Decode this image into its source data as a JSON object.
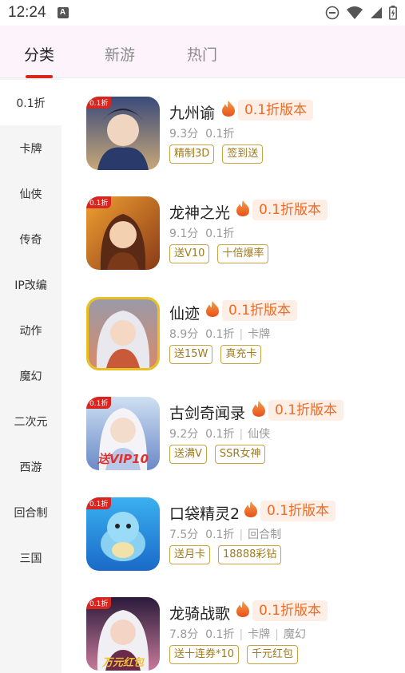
{
  "status_bar": {
    "time": "12:24",
    "notif_letter": "A"
  },
  "tabs": [
    {
      "label": "分类",
      "active": true
    },
    {
      "label": "新游",
      "active": false
    },
    {
      "label": "热门",
      "active": false
    }
  ],
  "sidebar": {
    "items": [
      {
        "label": "0.1折",
        "active": true
      },
      {
        "label": "卡牌"
      },
      {
        "label": "仙侠"
      },
      {
        "label": "传奇"
      },
      {
        "label": "IP改编"
      },
      {
        "label": "动作"
      },
      {
        "label": "魔幻"
      },
      {
        "label": "二次元"
      },
      {
        "label": "西游"
      },
      {
        "label": "回合制"
      },
      {
        "label": "三国"
      }
    ]
  },
  "games": [
    {
      "name": "九州谕",
      "promo": "0.1折版本",
      "score": "9.3分",
      "discount": "0.1折",
      "categories": [],
      "tags": [
        "精制3D",
        "签到送"
      ],
      "icon_badge": "0.1折",
      "icon_text": ""
    },
    {
      "name": "龙神之光",
      "promo": "0.1折版本",
      "score": "9.1分",
      "discount": "0.1折",
      "categories": [],
      "tags": [
        "送V10",
        "十倍爆率"
      ],
      "icon_badge": "0.1折",
      "icon_text": ""
    },
    {
      "name": "仙迹",
      "promo": "0.1折版本",
      "score": "8.9分",
      "discount": "0.1折",
      "categories": [
        "卡牌"
      ],
      "tags": [
        "送15W",
        "真充卡"
      ],
      "icon_badge": "",
      "icon_text": ""
    },
    {
      "name": "古剑奇闻录",
      "promo": "0.1折版本",
      "score": "9.2分",
      "discount": "0.1折",
      "categories": [
        "仙侠"
      ],
      "tags": [
        "送满V",
        "SSR女神"
      ],
      "icon_badge": "0.1折",
      "icon_text": "送VIP10"
    },
    {
      "name": "口袋精灵2",
      "promo": "0.1折版本",
      "score": "7.5分",
      "discount": "0.1折",
      "categories": [
        "回合制"
      ],
      "tags": [
        "送月卡",
        "18888彩钻"
      ],
      "icon_badge": "0.1折",
      "icon_text": ""
    },
    {
      "name": "龙骑战歌",
      "promo": "0.1折版本",
      "score": "7.8分",
      "discount": "0.1折",
      "categories": [
        "卡牌",
        "魔幻"
      ],
      "tags": [
        "送十连券*10",
        "千元红包"
      ],
      "icon_badge": "0.1折",
      "icon_text": "万元红包"
    }
  ],
  "colors": {
    "accent_red": "#d8251f",
    "promo_orange": "#f06a22",
    "promo_bg": "#fdeee6",
    "tag_gold": "#c9a340"
  },
  "icons": {
    "status": [
      "dnd-icon",
      "wifi-icon",
      "signal-icon",
      "battery-icon"
    ],
    "promo": "fire-icon"
  }
}
